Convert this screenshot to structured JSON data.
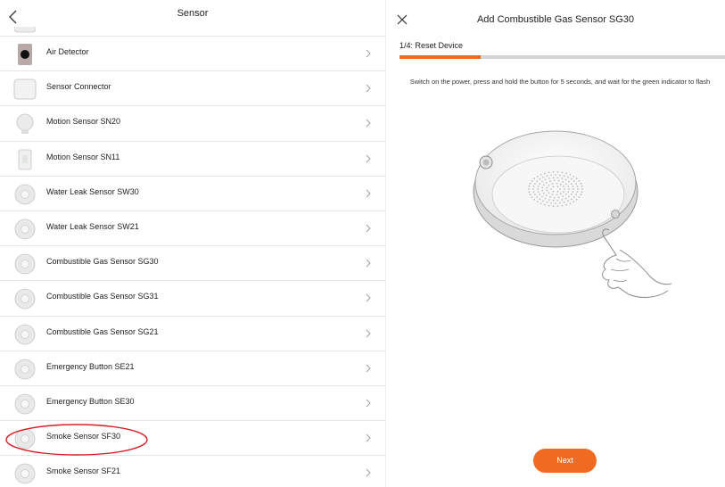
{
  "left": {
    "title": "Sensor",
    "items": [
      {
        "label": "Air Detector",
        "icon": "air-detector-icon"
      },
      {
        "label": "Sensor Connector",
        "icon": "sensor-connector-icon"
      },
      {
        "label": "Motion Sensor SN20",
        "icon": "motion-sensor-sn20-icon"
      },
      {
        "label": "Motion Sensor SN11",
        "icon": "motion-sensor-sn11-icon"
      },
      {
        "label": "Water Leak Sensor SW30",
        "icon": "water-leak-sensor-icon"
      },
      {
        "label": "Water Leak Sensor SW21",
        "icon": "water-leak-sensor-icon"
      },
      {
        "label": "Combustible Gas Sensor SG30",
        "icon": "gas-sensor-icon"
      },
      {
        "label": "Combustible Gas Sensor SG31",
        "icon": "gas-sensor-icon"
      },
      {
        "label": "Combustible Gas Sensor SG21",
        "icon": "gas-sensor-icon"
      },
      {
        "label": "Emergency Button SE21",
        "icon": "emergency-button-icon"
      },
      {
        "label": "Emergency Button SE30",
        "icon": "emergency-button-icon"
      },
      {
        "label": "Smoke Sensor SF30",
        "icon": "smoke-sensor-icon"
      },
      {
        "label": "Smoke Sensor SF21",
        "icon": "smoke-sensor-icon"
      }
    ],
    "highlighted_item": "Smoke Sensor SF30"
  },
  "right": {
    "title": "Add Combustible Gas Sensor SG30",
    "step_label": "1/4: Reset Device",
    "progress": 0.25,
    "instruction": "Switch on the power, press and hold the button for 5 seconds, and wait for the green indicator to flash",
    "next_label": "Next"
  },
  "colors": {
    "accent": "#f06a22",
    "highlight_ring": "#d8202a",
    "progress_track": "#d4d4d4"
  }
}
